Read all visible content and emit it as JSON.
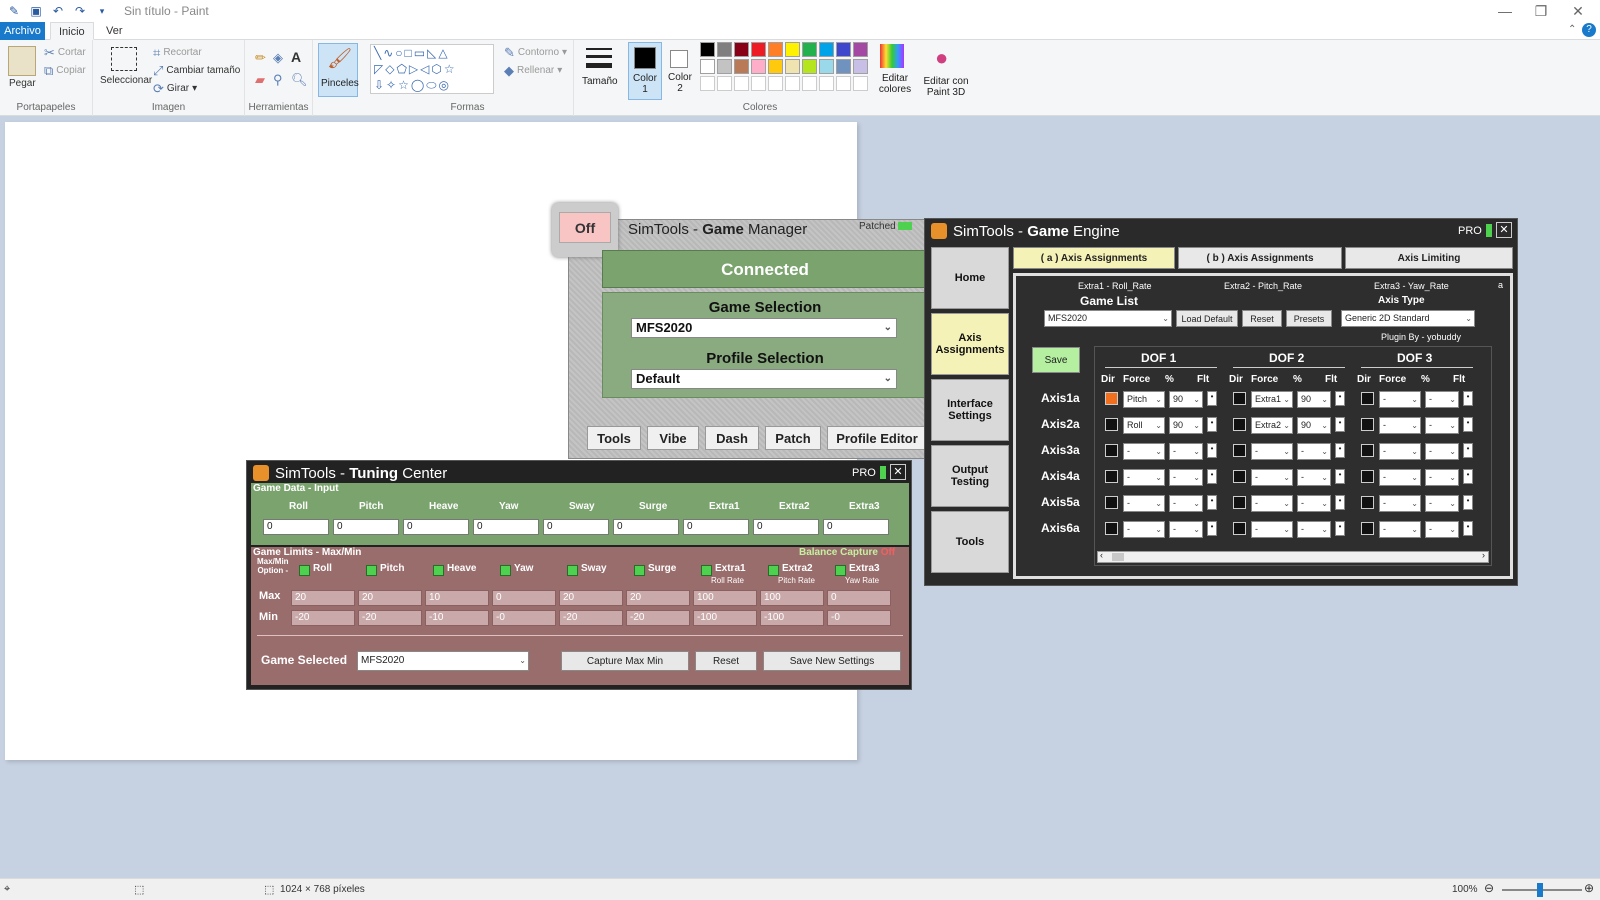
{
  "paint": {
    "title": "Sin título - Paint",
    "menu": {
      "archivo": "Archivo",
      "inicio": "Inicio",
      "ver": "Ver"
    },
    "ribbon": {
      "portapapeles": {
        "label": "Portapapeles",
        "pegar": "Pegar",
        "cortar": "Cortar",
        "copiar": "Copiar"
      },
      "imagen": {
        "label": "Imagen",
        "seleccionar": "Seleccionar",
        "recortar": "Recortar",
        "cambiar_tamano": "Cambiar tamaño",
        "girar": "Girar"
      },
      "herramientas": {
        "label": "Herramientas"
      },
      "pinceles": "Pinceles",
      "formas": {
        "label": "Formas",
        "contorno": "Contorno",
        "rellenar": "Rellenar"
      },
      "tamano": "Tamaño",
      "color1": "Color 1",
      "color2": "Color 2",
      "colores": {
        "label": "Colores",
        "editar": "Editar colores"
      },
      "paint3d": "Editar con Paint 3D",
      "palette": [
        "#000000",
        "#7f7f7f",
        "#880015",
        "#ed1c24",
        "#ff7f27",
        "#fff200",
        "#22b14c",
        "#00a2e8",
        "#3f48cc",
        "#a349a4",
        "#ffffff",
        "#c3c3c3",
        "#b97a57",
        "#ffaec9",
        "#ffc90e",
        "#efe4b0",
        "#b5e61d",
        "#99d9ea",
        "#7092be",
        "#c8bfe7"
      ]
    },
    "status": {
      "dimensions": "1024 × 768 píxeles",
      "zoom": "100%"
    }
  },
  "game_manager": {
    "off": "Off",
    "title_a": "SimTools - ",
    "title_b": "Game",
    "title_c": " Manager",
    "patched": "Patched",
    "connected": "Connected",
    "game_selection_label": "Game Selection",
    "game_selection": "MFS2020",
    "profile_selection_label": "Profile Selection",
    "profile_selection": "Default",
    "tabs": [
      "Tools",
      "Vibe",
      "Dash",
      "Patch",
      "Profile Editor"
    ]
  },
  "game_engine": {
    "title_a": "SimTools - ",
    "title_b": "Game",
    "title_c": " Engine",
    "pro": "PRO",
    "nav": [
      "Home",
      "Axis Assignments",
      "Interface Settings",
      "Output Testing",
      "Tools"
    ],
    "tabs": [
      "( a ) Axis Assignments",
      "( b ) Axis Assignments",
      "Axis Limiting"
    ],
    "extra_labels": [
      "Extra1 - Roll_Rate",
      "Extra2 - Pitch_Rate",
      "Extra3 - Yaw_Rate"
    ],
    "corner": "a",
    "game_list_label": "Game List",
    "game_list": "MFS2020",
    "load_default": "Load Default",
    "reset": "Reset",
    "presets": "Presets",
    "axis_type_label": "Axis Type",
    "axis_type": "Generic 2D Standard",
    "plugin_by": "Plugin By - yobuddy",
    "save": "Save",
    "dof": [
      "DOF 1",
      "DOF 2",
      "DOF 3"
    ],
    "col_headers": [
      "Dir",
      "Force",
      "%",
      "Flt"
    ],
    "axes": [
      {
        "name": "Axis1a",
        "dof1_force": "Pitch",
        "dof1_pct": "90",
        "dof2_force": "Extra1",
        "dof2_pct": "90",
        "dof3_force": "-",
        "dof3_pct": "-"
      },
      {
        "name": "Axis2a",
        "dof1_force": "Roll",
        "dof1_pct": "90",
        "dof2_force": "Extra2",
        "dof2_pct": "90",
        "dof3_force": "-",
        "dof3_pct": "-"
      },
      {
        "name": "Axis3a",
        "dof1_force": "-",
        "dof1_pct": "-",
        "dof2_force": "-",
        "dof2_pct": "-",
        "dof3_force": "-",
        "dof3_pct": "-"
      },
      {
        "name": "Axis4a",
        "dof1_force": "-",
        "dof1_pct": "-",
        "dof2_force": "-",
        "dof2_pct": "-",
        "dof3_force": "-",
        "dof3_pct": "-"
      },
      {
        "name": "Axis5a",
        "dof1_force": "-",
        "dof1_pct": "-",
        "dof2_force": "-",
        "dof2_pct": "-",
        "dof3_force": "-",
        "dof3_pct": "-"
      },
      {
        "name": "Axis6a",
        "dof1_force": "-",
        "dof1_pct": "-",
        "dof2_force": "-",
        "dof2_pct": "-",
        "dof3_force": "-",
        "dof3_pct": "-"
      }
    ]
  },
  "tuning_center": {
    "title_a": "SimTools - ",
    "title_b": "Tuning",
    "title_c": " Center",
    "pro": "PRO",
    "input_label": "Game Data - Input",
    "input_cols": [
      "Roll",
      "Pitch",
      "Heave",
      "Yaw",
      "Sway",
      "Surge",
      "Extra1",
      "Extra2",
      "Extra3"
    ],
    "input_values": [
      "0",
      "0",
      "0",
      "0",
      "0",
      "0",
      "0",
      "0",
      "0"
    ],
    "limits_label": "Game Limits - Max/Min",
    "balance_capture": "Balance Capture",
    "balance_state": "Off",
    "option_label_1": "Max/Min",
    "option_label_2": "Option -",
    "option_cols": [
      "Roll",
      "Pitch",
      "Heave",
      "Yaw",
      "Sway",
      "Surge",
      "Extra1",
      "Extra2",
      "Extra3"
    ],
    "sub_labels": [
      "Roll Rate",
      "Pitch Rate",
      "Yaw Rate"
    ],
    "max_label": "Max",
    "min_label": "Min",
    "max_values": [
      "20",
      "20",
      "10",
      "0",
      "20",
      "20",
      "100",
      "100",
      "0"
    ],
    "min_values": [
      "-20",
      "-20",
      "-10",
      "-0",
      "-20",
      "-20",
      "-100",
      "-100",
      "-0"
    ],
    "game_selected_label": "Game Selected",
    "game_selected": "MFS2020",
    "capture": "Capture Max Min",
    "reset": "Reset",
    "save": "Save New Settings"
  }
}
